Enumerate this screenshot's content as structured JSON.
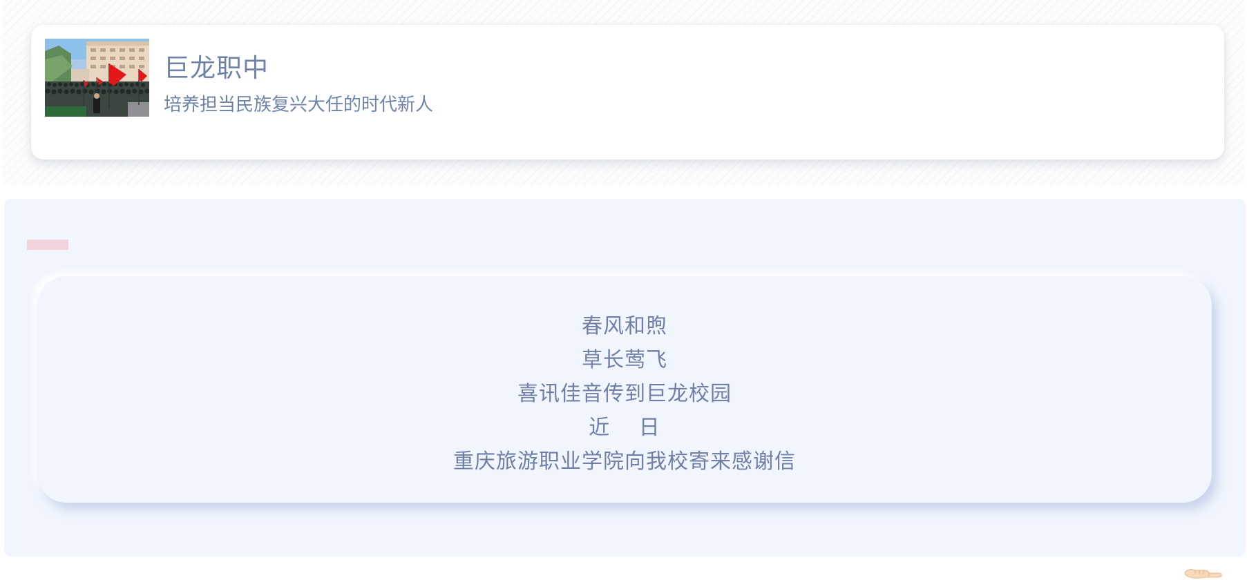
{
  "profile": {
    "name": "巨龙职中",
    "motto": "培养担当民族复兴大任的时代新人",
    "photo_icon": "school-assembly-photo"
  },
  "article": {
    "lines": [
      "春风和煦",
      "草长莺飞",
      "喜讯佳音传到巨龙校园",
      "近　 日",
      "重庆旅游职业学院向我校寄来感谢信"
    ]
  },
  "colors": {
    "title_text": "#6f82a8",
    "body_text": "#6f7fa6",
    "panel_bg": "#f0f5fe",
    "accent": "#f2d3dc"
  },
  "icons": {
    "corner": "pointing-hand-icon"
  }
}
